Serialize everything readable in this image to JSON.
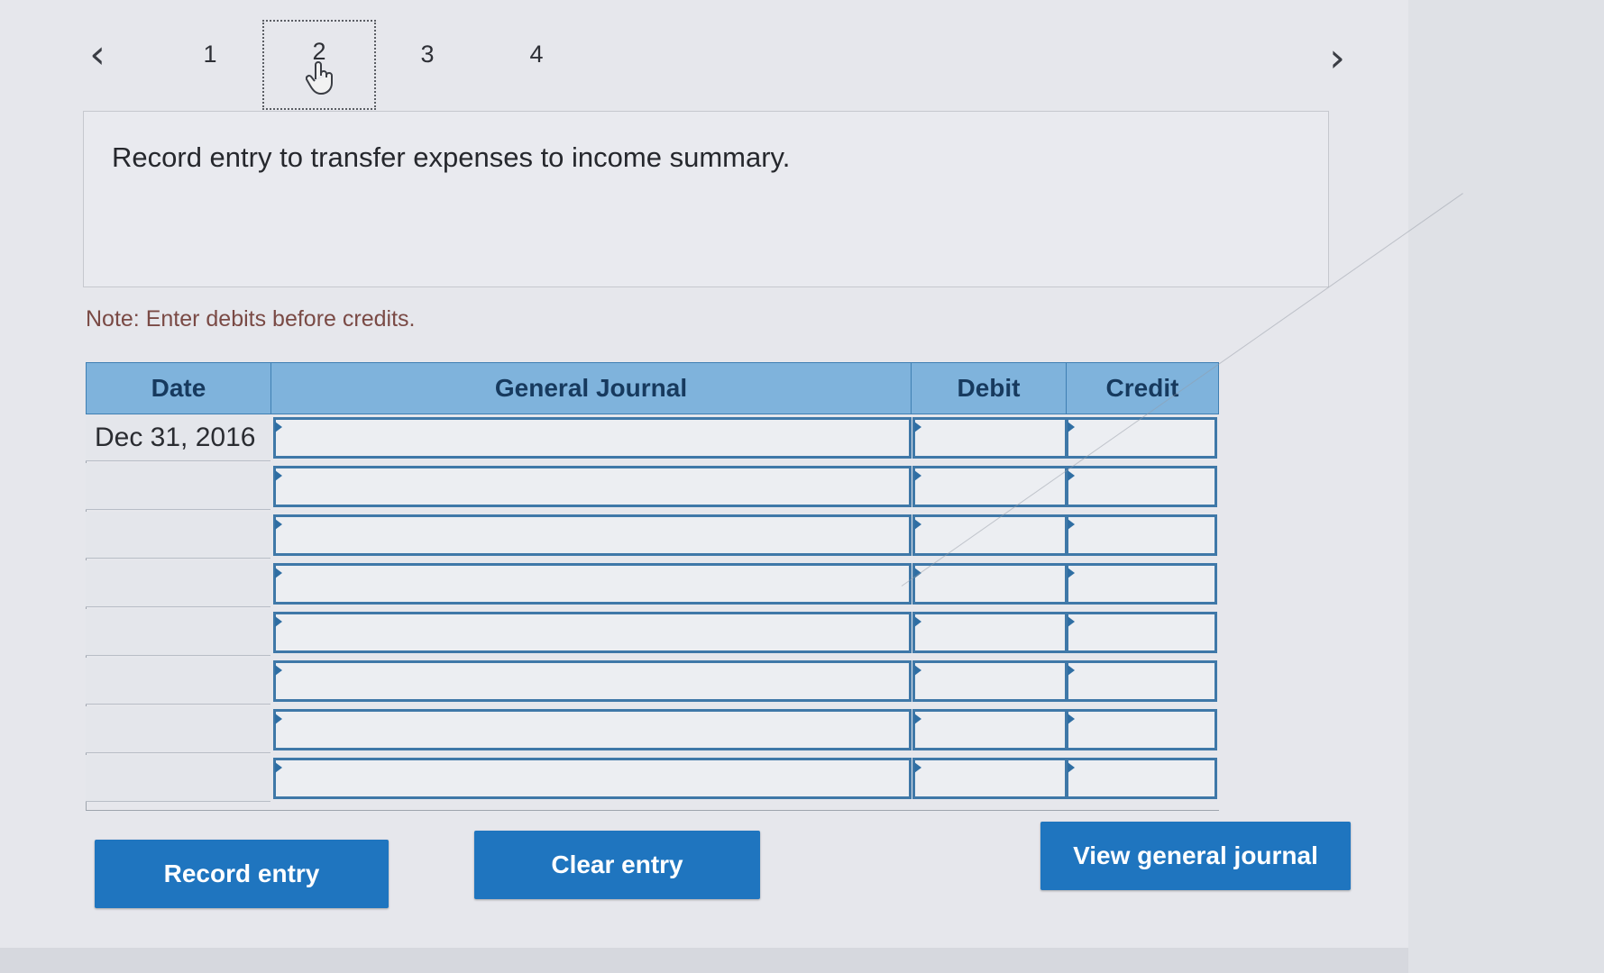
{
  "pagination": {
    "prev_icon": "chevron-left-icon",
    "next_icon": "chevron-right-icon",
    "pages": [
      "1",
      "2",
      "3",
      "4"
    ],
    "current_page": "2"
  },
  "instruction": "Record entry to transfer expenses to income summary.",
  "note": "Note: Enter debits before credits.",
  "journal": {
    "headers": {
      "date": "Date",
      "general_journal": "General Journal",
      "debit": "Debit",
      "credit": "Credit"
    },
    "rows": [
      {
        "date": "Dec 31, 2016",
        "account": "",
        "debit": "",
        "credit": ""
      },
      {
        "date": "",
        "account": "",
        "debit": "",
        "credit": ""
      },
      {
        "date": "",
        "account": "",
        "debit": "",
        "credit": ""
      },
      {
        "date": "",
        "account": "",
        "debit": "",
        "credit": ""
      },
      {
        "date": "",
        "account": "",
        "debit": "",
        "credit": ""
      },
      {
        "date": "",
        "account": "",
        "debit": "",
        "credit": ""
      },
      {
        "date": "",
        "account": "",
        "debit": "",
        "credit": ""
      },
      {
        "date": "",
        "account": "",
        "debit": "",
        "credit": ""
      }
    ]
  },
  "buttons": {
    "record": "Record entry",
    "clear": "Clear entry",
    "view": "View general journal"
  },
  "colors": {
    "header_bg": "#7fb3dc",
    "button_bg": "#1f75bf",
    "input_border": "#3f78a8"
  }
}
